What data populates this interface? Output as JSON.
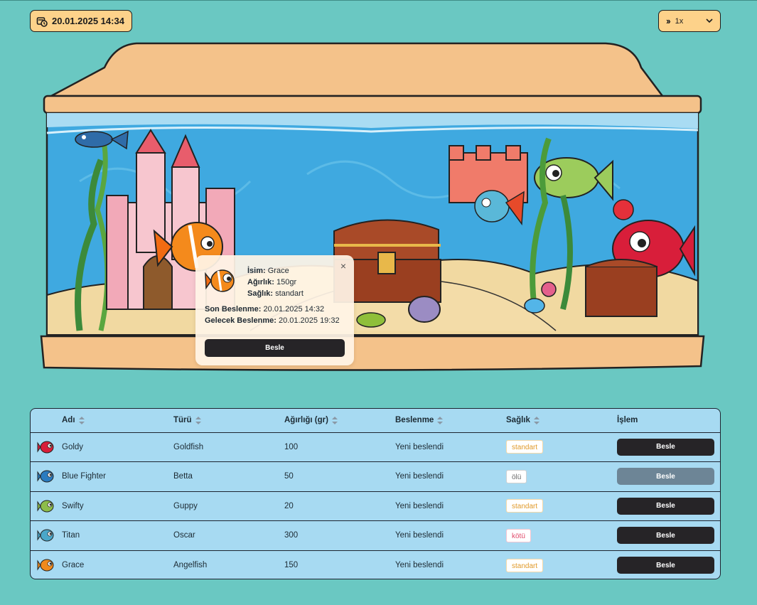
{
  "header": {
    "datetime": "20.01.2025 14:34",
    "speed": "1x"
  },
  "popup": {
    "name_label": "İsim:",
    "name": "Grace",
    "weight_label": "Ağırlık:",
    "weight": "150gr",
    "health_label": "Sağlık:",
    "health": "standart",
    "last_feed_label": "Son Beslenme:",
    "last_feed": "20.01.2025 14:32",
    "next_feed_label": "Gelecek Beslenme:",
    "next_feed": "20.01.2025 19:32",
    "feed_button": "Besle",
    "close": "×"
  },
  "table": {
    "headers": [
      "Adı",
      "Türü",
      "Ağırlığı (gr)",
      "Beslenme",
      "Sağlık",
      "İşlem"
    ],
    "rows": [
      {
        "name": "Goldy",
        "type": "Goldfish",
        "weight": "100",
        "feeding": "Yeni beslendi",
        "health": "standart",
        "action": "Besle",
        "color": "#d81e3a"
      },
      {
        "name": "Blue Fighter",
        "type": "Betta",
        "weight": "50",
        "feeding": "Yeni beslendi",
        "health": "ölü",
        "action": "Besle",
        "color": "#2a7bbf"
      },
      {
        "name": "Swifty",
        "type": "Guppy",
        "weight": "20",
        "feeding": "Yeni beslendi",
        "health": "standart",
        "action": "Besle",
        "color": "#8dbd4a"
      },
      {
        "name": "Titan",
        "type": "Oscar",
        "weight": "300",
        "feeding": "Yeni beslendi",
        "health": "kötü",
        "action": "Besle",
        "color": "#4aa7c9"
      },
      {
        "name": "Grace",
        "type": "Angelfish",
        "weight": "150",
        "feeding": "Yeni beslendi",
        "health": "standart",
        "action": "Besle",
        "color": "#f08a1c"
      }
    ]
  }
}
